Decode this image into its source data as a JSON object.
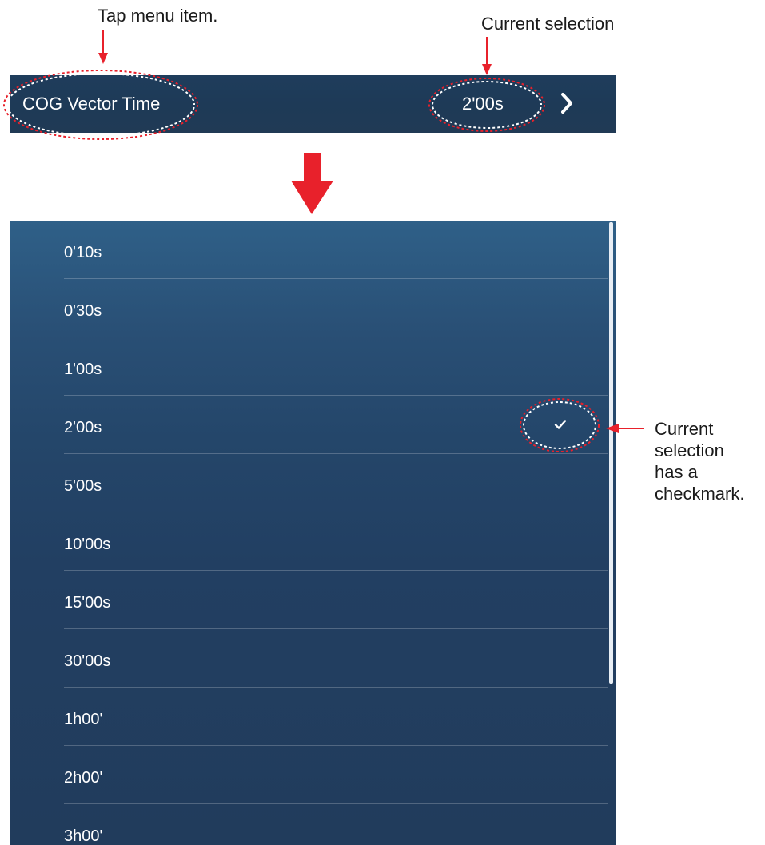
{
  "callouts": {
    "tap_menu_item": "Tap menu item.",
    "current_selection": "Current selection",
    "checkmark_note": [
      "Current",
      "selection",
      "has a",
      "checkmark."
    ]
  },
  "menu_row": {
    "label": "COG Vector Time",
    "value": "2'00s",
    "chevron_icon": "chevron-right-icon"
  },
  "options": [
    {
      "label": "0'10s",
      "selected": false
    },
    {
      "label": "0'30s",
      "selected": false
    },
    {
      "label": "1'00s",
      "selected": false
    },
    {
      "label": "2'00s",
      "selected": true
    },
    {
      "label": "5'00s",
      "selected": false
    },
    {
      "label": "10'00s",
      "selected": false
    },
    {
      "label": "15'00s",
      "selected": false
    },
    {
      "label": "30'00s",
      "selected": false
    },
    {
      "label": "1h00'",
      "selected": false
    },
    {
      "label": "2h00'",
      "selected": false
    },
    {
      "label": "3h00'",
      "selected": false
    }
  ],
  "colors": {
    "annotation_red": "#e8212b",
    "panel_dark": "#213c5c",
    "panel_top": "#2f6088",
    "text": "#ffffff"
  },
  "icons": {
    "selected_mark": "checkmark-icon",
    "transition_arrow": "down-arrow-icon"
  }
}
